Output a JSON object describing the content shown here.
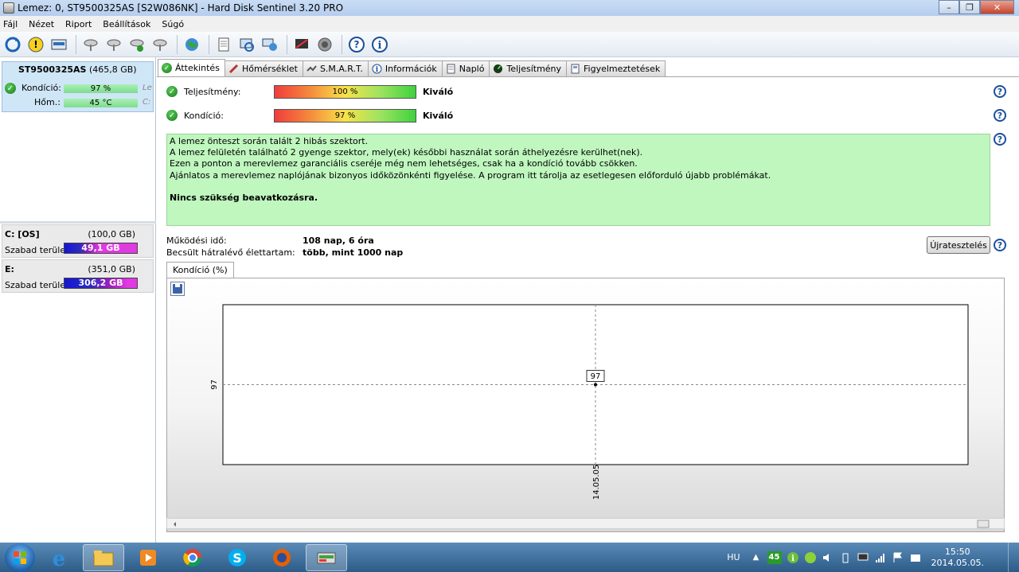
{
  "window": {
    "title": "Lemez: 0, ST9500325AS [S2W086NK]  -  Hard Disk Sentinel 3.20 PRO",
    "minimize_glyph": "–",
    "maximize_glyph": "❐",
    "close_glyph": "✕"
  },
  "menu": [
    "Fájl",
    "Nézet",
    "Riport",
    "Beállítások",
    "Súgó"
  ],
  "disk": {
    "model": "ST9500325AS",
    "capacity": "(465,8 GB)",
    "condition_label": "Kondíció:",
    "condition_value": "97 %",
    "temp_label": "Hőm.:",
    "temp_value": "45 °C",
    "cut_1": "Le",
    "cut_2": "C:"
  },
  "volumes": [
    {
      "name": "C: [OS]",
      "size": "(100,0 GB)",
      "free_label": "Szabad terület",
      "free_value": "49,1 GB",
      "free_fraction": 0.49
    },
    {
      "name": "E:",
      "size": "(351,0 GB)",
      "free_label": "Szabad terület",
      "free_value": "306,2 GB",
      "free_fraction": 0.87
    }
  ],
  "tabs": [
    "Áttekintés",
    "Hőmérséklet",
    "S.M.A.R.T.",
    "Információk",
    "Napló",
    "Teljesítmény",
    "Figyelmeztetések"
  ],
  "overview": {
    "performance_label": "Teljesítmény:",
    "performance_value": "100 %",
    "performance_rating": "Kiváló",
    "condition_label": "Kondíció:",
    "condition_value": "97 %",
    "condition_rating": "Kiváló",
    "message_lines": [
      "A lemez önteszt során talált 2 hibás szektort.",
      "A lemez felületén található 2 gyenge szektor, mely(ek) későbbi használat során áthelyezésre kerülhet(nek).",
      "Ezen a ponton a merevlemez garanciális cseréje még nem lehetséges, csak ha a kondíció tovább csökken.",
      "Ajánlatos a merevlemez naplójának bizonyos időközönkénti figyelése. A program itt tárolja az esetlegesen előforduló újabb problémákat."
    ],
    "message_conclusion": "Nincs szükség beavatkozásra.",
    "uptime_label": "Működési idő:",
    "uptime_value": "108 nap, 6 óra",
    "lifetime_label": "Becsült hátralévő élettartam:",
    "lifetime_value": "több, mint 1000 nap",
    "retest_button": "Újratesztelés"
  },
  "chart_data": {
    "type": "line",
    "tab_label": "Kondíció  (%)",
    "x": [
      "14.05.05"
    ],
    "series": [
      {
        "values": [
          97
        ]
      }
    ],
    "y_tick": "97",
    "point_label": "97",
    "title": "",
    "xlabel": "",
    "ylabel": ""
  },
  "taskbar": {
    "lang": "HU",
    "tray_badge": "45",
    "time": "15:50",
    "date": "2014.05.05."
  },
  "colors": {
    "check_green": "#1b7a1b",
    "message_bg": "#bff7bf",
    "help_blue": "#1b4f9c",
    "free_bar_start": "#1515d6",
    "free_bar_end": "#e13ae2"
  }
}
